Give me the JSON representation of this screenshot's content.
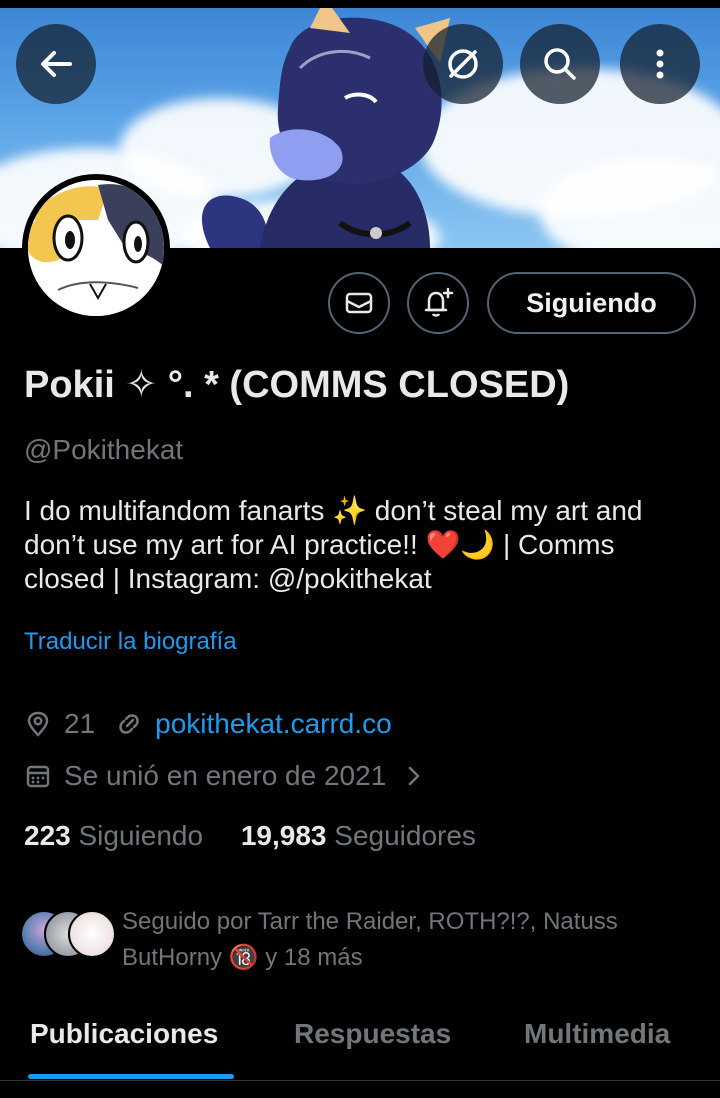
{
  "profile": {
    "name": "Pokii ✧ °. * (COMMS CLOSED)",
    "handle": "@Pokithekat",
    "bio": "I do multifandom fanarts ✨ don’t steal my art and don’t use my art for AI practice!! ❤️🌙 | Comms closed | Instagram: @/pokithekat",
    "translate_label": "Traducir la biografía",
    "location": "21",
    "website": "pokithekat.carrd.co",
    "joined": "Se unió en enero de 2021"
  },
  "actions": {
    "follow_label": "Siguiendo",
    "message_icon": "mail-icon",
    "notify_icon": "bell-plus-icon"
  },
  "header_buttons": {
    "back_icon": "arrow-left-icon",
    "hide_icon": "eye-slash-icon",
    "search_icon": "search-icon",
    "more_icon": "more-vertical-icon"
  },
  "stats": {
    "following_count": "223",
    "following_label": "Siguiendo",
    "followers_count": "19,983",
    "followers_label": "Seguidores"
  },
  "followed_by": {
    "text": "Seguido por Tarr the Raider, ROTH?!?, Natuss ButHorny 🔞 y 18 más"
  },
  "tabs": [
    {
      "label": "Publicaciones",
      "active": true
    },
    {
      "label": "Respuestas",
      "active": false
    },
    {
      "label": "Multimedia",
      "active": false
    }
  ],
  "colors": {
    "accent": "#1d9bf0",
    "background": "#000000",
    "text_primary": "#e7e9ea",
    "text_secondary": "#71767b",
    "border": "#536471"
  }
}
